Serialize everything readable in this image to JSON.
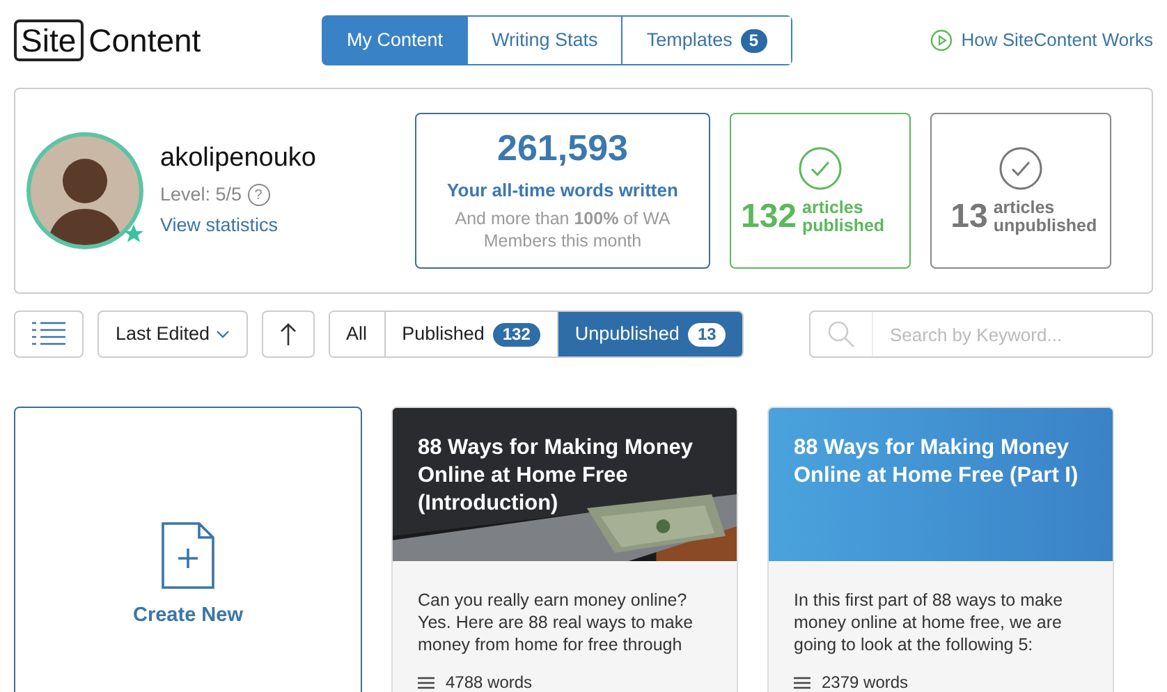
{
  "logo": {
    "boxed": "Site",
    "rest": "Content"
  },
  "tabs": [
    {
      "label": "My Content",
      "selected": true
    },
    {
      "label": "Writing Stats",
      "selected": false
    },
    {
      "label": "Templates",
      "selected": false,
      "count": "5"
    }
  ],
  "help_link": "How SiteContent Works",
  "profile": {
    "username": "akolipenouko",
    "level": "Level: 5/5",
    "help": "?",
    "link": "View statistics"
  },
  "stats": [
    {
      "kind": "words",
      "value": "261,593",
      "label": "Your all-time words written",
      "note": "And more than **100%** of WA Members this month"
    },
    {
      "kind": "published",
      "value": "132",
      "label": "articles published"
    },
    {
      "kind": "unpublished",
      "value": "13",
      "label": "articles unpublished"
    }
  ],
  "toolbar": {
    "sort": "Last Edited",
    "search_placeholder": "Search by Keyword..."
  },
  "filters": [
    {
      "label": "All",
      "selected": false
    },
    {
      "label": "Published",
      "selected": false,
      "count": "132"
    },
    {
      "label": "Unpublished",
      "selected": true,
      "count": "13"
    }
  ],
  "create_new": "Create New",
  "articles": [
    {
      "kind": "picture",
      "title": "88 Ways for Making Money Online at Home Free (Introduction)",
      "excerpt": "Can you really earn money online? Yes. Here are 88 real ways to make money from home for free through",
      "words": "4788 words"
    },
    {
      "kind": "gradient",
      "title": "88 Ways for Making Money Online at Home Free (Part I)",
      "excerpt": "In this first part of 88 ways to make money online at home free, we are going to look at the following 5:",
      "words": "2379 words"
    }
  ]
}
